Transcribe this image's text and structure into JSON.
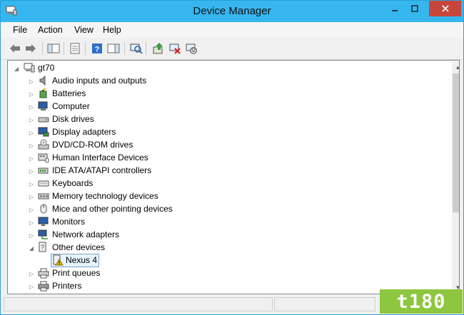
{
  "window": {
    "title": "Device Manager"
  },
  "menu": {
    "file": "File",
    "action": "Action",
    "view": "View",
    "help": "Help"
  },
  "tree": {
    "root": "gt70",
    "categories": [
      "Audio inputs and outputs",
      "Batteries",
      "Computer",
      "Disk drives",
      "Display adapters",
      "DVD/CD-ROM drives",
      "Human Interface Devices",
      "IDE ATA/ATAPI controllers",
      "Keyboards",
      "Memory technology devices",
      "Mice and other pointing devices",
      "Monitors",
      "Network adapters",
      "Other devices"
    ],
    "other_device_child": "Nexus 4",
    "after": [
      "Print queues",
      "Printers"
    ]
  },
  "watermark": "t180",
  "colors": {
    "titlebar": "#35b6ee",
    "close": "#c7463b",
    "selection": "#e5f3fb",
    "logo": "#8dc63f"
  }
}
